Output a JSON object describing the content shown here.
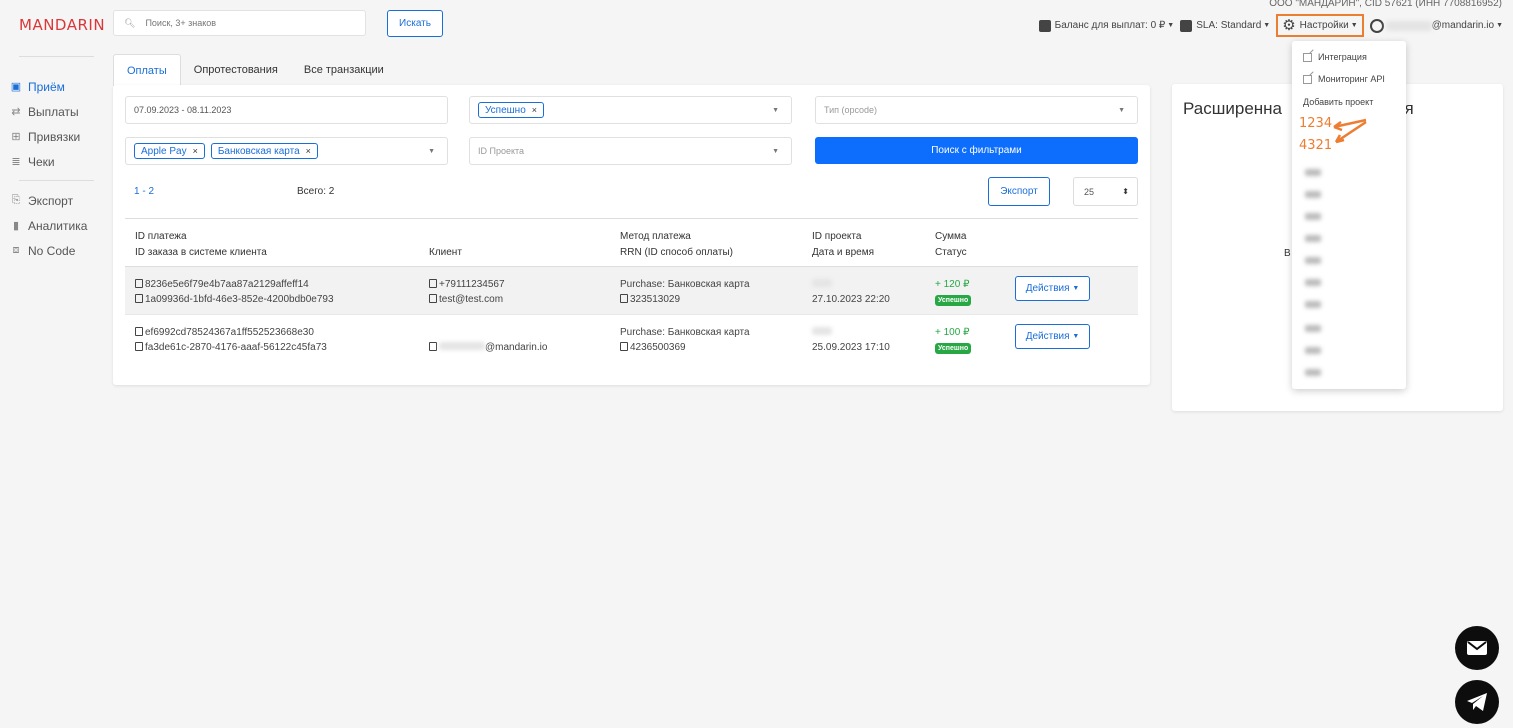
{
  "header": {
    "logo": "MANDARIN",
    "search_placeholder": "Поиск, 3+ знаков",
    "search_button": "Искать",
    "company": "ООО \"МАНДАРИН\", CID 57621 (ИНН 7708816952)",
    "balance": "Баланс для выплат: 0 ₽",
    "sla": "SLA: Standard",
    "settings": "Настройки",
    "user_email_suffix": "@mandarin.io"
  },
  "sidebar": {
    "items": [
      {
        "label": "Приём",
        "icon": "receipt-icon"
      },
      {
        "label": "Выплаты",
        "icon": "payout-icon"
      },
      {
        "label": "Привязки",
        "icon": "link-icon"
      },
      {
        "label": "Чеки",
        "icon": "check-icon"
      }
    ],
    "items2": [
      {
        "label": "Экспорт",
        "icon": "export-icon"
      },
      {
        "label": "Аналитика",
        "icon": "analytics-icon"
      },
      {
        "label": "No Code",
        "icon": "code-icon"
      }
    ]
  },
  "tabs": [
    "Оплаты",
    "Опротестования",
    "Все транзакции"
  ],
  "filters": {
    "date_range": "07.09.2023 - 08.11.2023",
    "status_tag": "Успешно",
    "type_placeholder": "Тип (opcode)",
    "method_tags": [
      "Apple Pay",
      "Банковская карта"
    ],
    "project_placeholder": "ID Проекта",
    "search_button": "Поиск с фильтрами"
  },
  "list": {
    "range": "1 - 2",
    "total": "Всего: 2",
    "export_button": "Экспорт",
    "per_page": "25"
  },
  "table": {
    "headers": {
      "c1a": "ID платежа",
      "c1b": "ID заказа в системе клиента",
      "c2": "Клиент",
      "c3a": "Метод платежа",
      "c3b": "RRN (ID способ оплаты)",
      "c4a": "ID проекта",
      "c4b": "Дата и время",
      "c5a": "Сумма",
      "c5b": "Статус"
    },
    "rows": [
      {
        "payment_id": "8236e5e6f79e4b7aa87a2129affeff14",
        "order_id": "1a09936d-1bfd-46e3-852e-4200bdb0e793",
        "client1": "+79111234567",
        "client2": "test@test.com",
        "method": "Purchase: Банковская карта",
        "rrn": "323513029",
        "datetime": "27.10.2023 22:20",
        "amount": "+ 120 ₽",
        "status": "Успешно",
        "action": "Действия"
      },
      {
        "payment_id": "ef6992cd78524367a1ff552523668e30",
        "order_id": "fa3de61c-2870-4176-aaaf-56122c45fa73",
        "client1": "",
        "client2": "@mandarin.io",
        "method": "Purchase: Банковская карта",
        "rrn": "4236500369",
        "datetime": "25.09.2023 17:10",
        "amount": "+ 100 ₽",
        "status": "Успешно",
        "action": "Действия"
      }
    ]
  },
  "right_panel": {
    "title_left": "Расширенна",
    "title_right": "ия",
    "fragment": "В"
  },
  "settings_menu": {
    "items": [
      "Интеграция",
      "Мониторинг API",
      "Добавить проект"
    ],
    "projects": [
      "1234",
      "4321"
    ]
  },
  "colors": {
    "accent": "#1a6ed8",
    "primary_button": "#0d6efd",
    "logo": "#d9383a",
    "highlight": "#ed7d31",
    "success": "#28a745"
  }
}
